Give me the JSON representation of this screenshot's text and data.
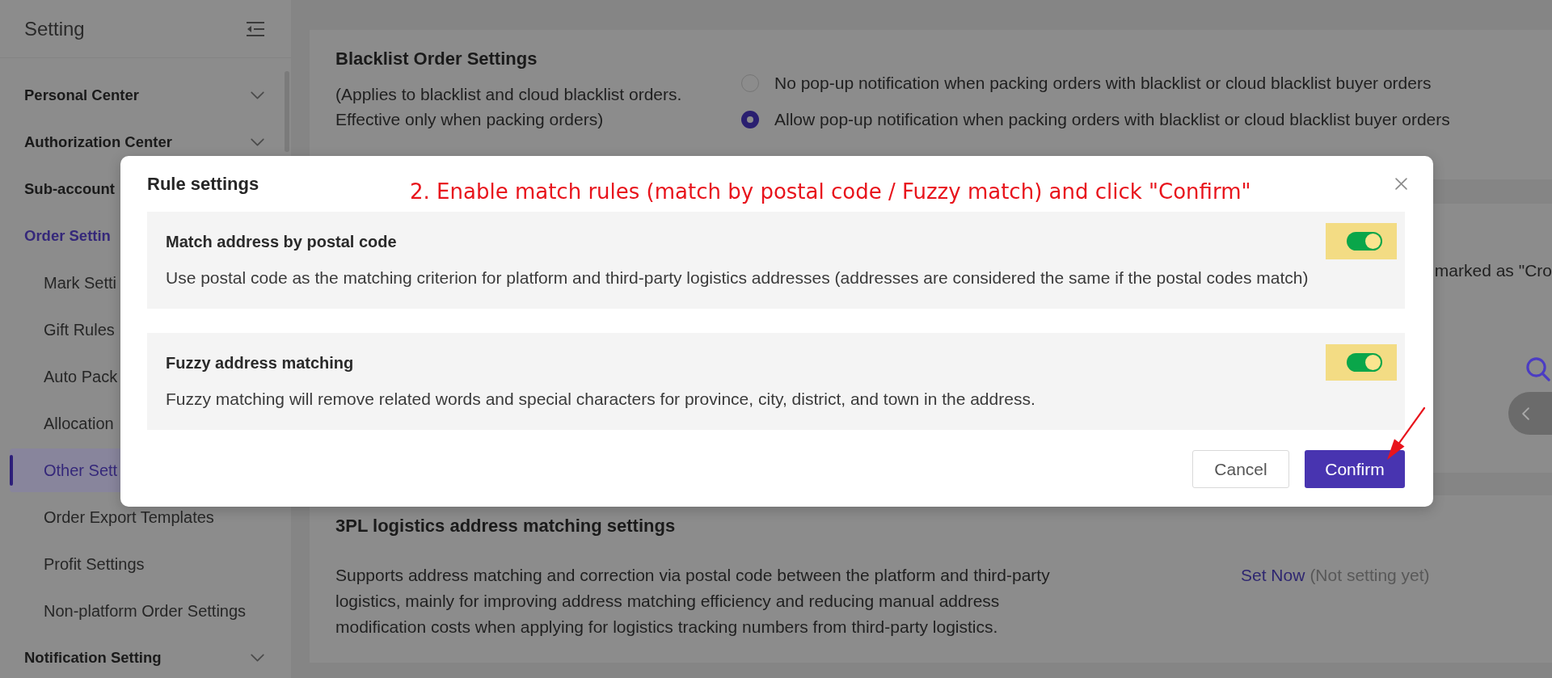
{
  "sidebar": {
    "title": "Setting",
    "items": [
      {
        "label": "Personal Center",
        "active": false,
        "expanded": false
      },
      {
        "label": "Authorization Center",
        "active": false,
        "expanded": false
      },
      {
        "label": "Sub-account",
        "active": false
      },
      {
        "label": "Order Settin",
        "active": true,
        "children": [
          {
            "label": "Mark Setti",
            "selected": false
          },
          {
            "label": "Gift Rules",
            "selected": false
          },
          {
            "label": "Auto Pack",
            "selected": false
          },
          {
            "label": "Allocation",
            "selected": false
          },
          {
            "label": "Other Sett",
            "selected": true
          },
          {
            "label": "Order Export Templates",
            "selected": false
          },
          {
            "label": "Profit Settings",
            "selected": false
          },
          {
            "label": "Non-platform Order Settings",
            "selected": false
          }
        ]
      },
      {
        "label": "Notification Setting",
        "active": false,
        "expanded": false
      }
    ]
  },
  "blacklist_settings": {
    "title": "Blacklist Order Settings",
    "description": "(Applies to blacklist and cloud blacklist orders. Effective only when packing orders)",
    "options": [
      {
        "label": "No pop-up notification when packing orders with blacklist or cloud blacklist buyer orders",
        "selected": false
      },
      {
        "label": "Allow pop-up notification when packing orders with blacklist or cloud blacklist buyer orders",
        "selected": true
      }
    ]
  },
  "covered_section": {
    "text": "marked as \"Cro"
  },
  "address_matching": {
    "title": "3PL logistics address matching settings",
    "description": "Supports address matching and correction via postal code between the platform and third-party logistics, mainly for improving address matching efficiency and reducing manual address modification costs when applying for logistics tracking numbers from third-party logistics.",
    "link": "Set Now",
    "status": "(Not setting yet)"
  },
  "dialog": {
    "title": "Rule settings",
    "annotation": "2. Enable match rules (match by postal code / Fuzzy match) and click \"Confirm\"",
    "rules": [
      {
        "title": "Match address by postal code",
        "description": "Use postal code as the matching criterion for platform and third-party logistics addresses (addresses are considered the same if the postal codes match)",
        "on": true
      },
      {
        "title": "Fuzzy address matching",
        "description": "Fuzzy matching will remove related words and special characters for province, city, district, and town in the address.",
        "on": true
      }
    ],
    "buttons": [
      {
        "label": "Cancel",
        "kind": "secondary"
      },
      {
        "label": "Confirm",
        "kind": "primary"
      }
    ]
  }
}
